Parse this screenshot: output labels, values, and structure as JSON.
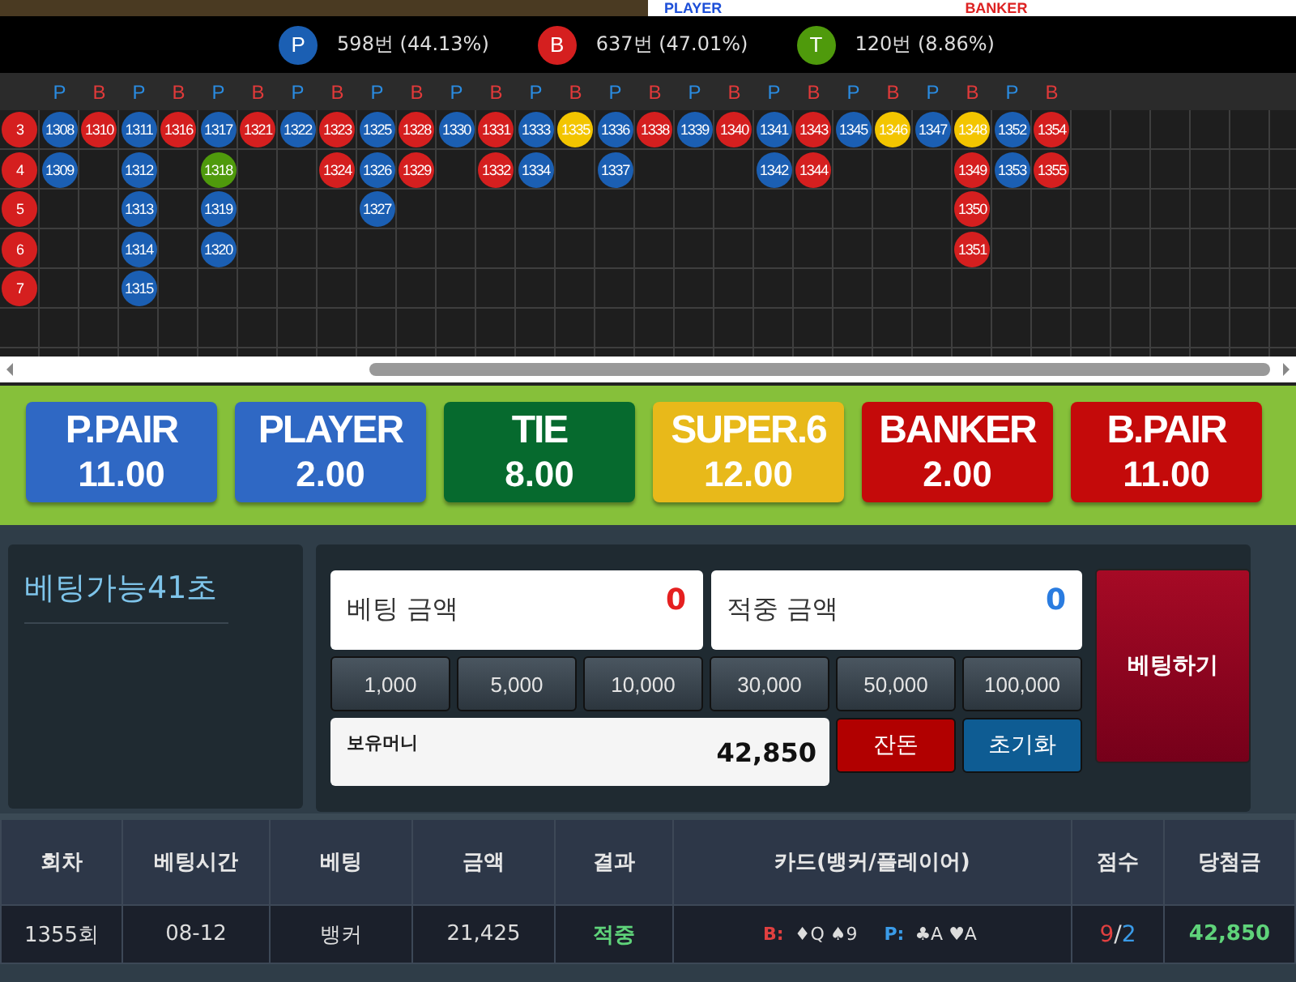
{
  "top_panel": {
    "player_label": "PLAYER",
    "banker_label": "BANKER"
  },
  "stats": [
    {
      "letter": "P",
      "text": "598번 (44.13%)",
      "color": "#1b5fb3"
    },
    {
      "letter": "B",
      "text": "637번 (47.01%)",
      "color": "#d51f1f"
    },
    {
      "letter": "T",
      "text": "120번 (8.86%)",
      "color": "#4f9a0c"
    }
  ],
  "road": {
    "columns": [
      {
        "cells": [
          {
            "n": "3",
            "kind": "banker"
          },
          {
            "n": "4",
            "kind": "banker"
          },
          {
            "n": "5",
            "kind": "banker"
          },
          {
            "n": "6",
            "kind": "banker"
          },
          {
            "n": "7",
            "kind": "banker"
          }
        ]
      },
      {
        "header": "P",
        "cells": [
          {
            "n": "1308",
            "kind": "player"
          },
          {
            "n": "1309",
            "kind": "player"
          }
        ]
      },
      {
        "header": "B",
        "cells": [
          {
            "n": "1310",
            "kind": "banker"
          }
        ]
      },
      {
        "header": "P",
        "cells": [
          {
            "n": "1311",
            "kind": "player"
          },
          {
            "n": "1312",
            "kind": "player"
          },
          {
            "n": "1313",
            "kind": "player"
          },
          {
            "n": "1314",
            "kind": "player"
          },
          {
            "n": "1315",
            "kind": "player"
          }
        ]
      },
      {
        "header": "B",
        "cells": [
          {
            "n": "1316",
            "kind": "banker"
          }
        ]
      },
      {
        "header": "P",
        "cells": [
          {
            "n": "1317",
            "kind": "player"
          },
          {
            "n": "1318",
            "kind": "tie"
          },
          {
            "n": "1319",
            "kind": "player"
          },
          {
            "n": "1320",
            "kind": "player"
          }
        ]
      },
      {
        "header": "B",
        "cells": [
          {
            "n": "1321",
            "kind": "banker"
          }
        ]
      },
      {
        "header": "P",
        "cells": [
          {
            "n": "1322",
            "kind": "player"
          }
        ]
      },
      {
        "header": "B",
        "cells": [
          {
            "n": "1323",
            "kind": "banker"
          },
          {
            "n": "1324",
            "kind": "banker"
          }
        ]
      },
      {
        "header": "P",
        "cells": [
          {
            "n": "1325",
            "kind": "player"
          },
          {
            "n": "1326",
            "kind": "player"
          },
          {
            "n": "1327",
            "kind": "player"
          }
        ]
      },
      {
        "header": "B",
        "cells": [
          {
            "n": "1328",
            "kind": "banker"
          },
          {
            "n": "1329",
            "kind": "banker"
          }
        ]
      },
      {
        "header": "P",
        "cells": [
          {
            "n": "1330",
            "kind": "player"
          }
        ]
      },
      {
        "header": "B",
        "cells": [
          {
            "n": "1331",
            "kind": "banker"
          },
          {
            "n": "1332",
            "kind": "banker"
          }
        ]
      },
      {
        "header": "P",
        "cells": [
          {
            "n": "1333",
            "kind": "player"
          },
          {
            "n": "1334",
            "kind": "player"
          }
        ]
      },
      {
        "header": "B",
        "cells": [
          {
            "n": "1335",
            "kind": "super6"
          }
        ]
      },
      {
        "header": "P",
        "cells": [
          {
            "n": "1336",
            "kind": "player"
          },
          {
            "n": "1337",
            "kind": "player"
          }
        ]
      },
      {
        "header": "B",
        "cells": [
          {
            "n": "1338",
            "kind": "banker"
          }
        ]
      },
      {
        "header": "P",
        "cells": [
          {
            "n": "1339",
            "kind": "player"
          }
        ]
      },
      {
        "header": "B",
        "cells": [
          {
            "n": "1340",
            "kind": "banker"
          }
        ]
      },
      {
        "header": "P",
        "cells": [
          {
            "n": "1341",
            "kind": "player"
          },
          {
            "n": "1342",
            "kind": "player"
          }
        ]
      },
      {
        "header": "B",
        "cells": [
          {
            "n": "1343",
            "kind": "banker"
          },
          {
            "n": "1344",
            "kind": "banker"
          }
        ]
      },
      {
        "header": "P",
        "cells": [
          {
            "n": "1345",
            "kind": "player"
          }
        ]
      },
      {
        "header": "B",
        "cells": [
          {
            "n": "1346",
            "kind": "super6"
          }
        ]
      },
      {
        "header": "P",
        "cells": [
          {
            "n": "1347",
            "kind": "player"
          }
        ]
      },
      {
        "header": "B",
        "cells": [
          {
            "n": "1348",
            "kind": "super6"
          },
          {
            "n": "1349",
            "kind": "banker"
          },
          {
            "n": "1350",
            "kind": "banker"
          },
          {
            "n": "1351",
            "kind": "banker"
          }
        ]
      },
      {
        "header": "P",
        "cells": [
          {
            "n": "1352",
            "kind": "player"
          },
          {
            "n": "1353",
            "kind": "player"
          }
        ]
      },
      {
        "header": "B",
        "cells": [
          {
            "n": "1354",
            "kind": "banker"
          },
          {
            "n": "1355",
            "kind": "banker"
          }
        ]
      }
    ]
  },
  "bet_options": [
    {
      "label": "P.PAIR",
      "odds": "11.00",
      "kind": "player"
    },
    {
      "label": "PLAYER",
      "odds": "2.00",
      "kind": "player"
    },
    {
      "label": "TIE",
      "odds": "8.00",
      "kind": "tie"
    },
    {
      "label": "SUPER.6",
      "odds": "12.00",
      "kind": "super6"
    },
    {
      "label": "BANKER",
      "odds": "2.00",
      "kind": "banker"
    },
    {
      "label": "B.PAIR",
      "odds": "11.00",
      "kind": "banker"
    }
  ],
  "timer": "베팅가능41초",
  "bet_amount": {
    "label": "베팅 금액",
    "value": "0"
  },
  "win_amount": {
    "label": "적중 금액",
    "value": "0"
  },
  "chips": [
    "1,000",
    "5,000",
    "10,000",
    "30,000",
    "50,000",
    "100,000"
  ],
  "balance": {
    "label": "보유머니",
    "value": "42,850"
  },
  "change_button": "잔돈",
  "reset_button": "초기화",
  "bet_button": "베팅하기",
  "history": {
    "columns": [
      "회차",
      "베팅시간",
      "베팅",
      "금액",
      "결과",
      "카드(뱅커/플레이어)",
      "점수",
      "당첨금"
    ],
    "rows": [
      {
        "round": "1355회",
        "time": "08-12",
        "bet": "뱅커",
        "amount": "21,425",
        "result": "적중",
        "won": true,
        "banker_label": "B:",
        "banker_cards": "♦Q ♠9",
        "player_label": "P:",
        "player_cards": "♣A ♥A",
        "banker_score": "9",
        "score_sep": "/",
        "player_score": "2",
        "payout": "42,850"
      }
    ]
  }
}
